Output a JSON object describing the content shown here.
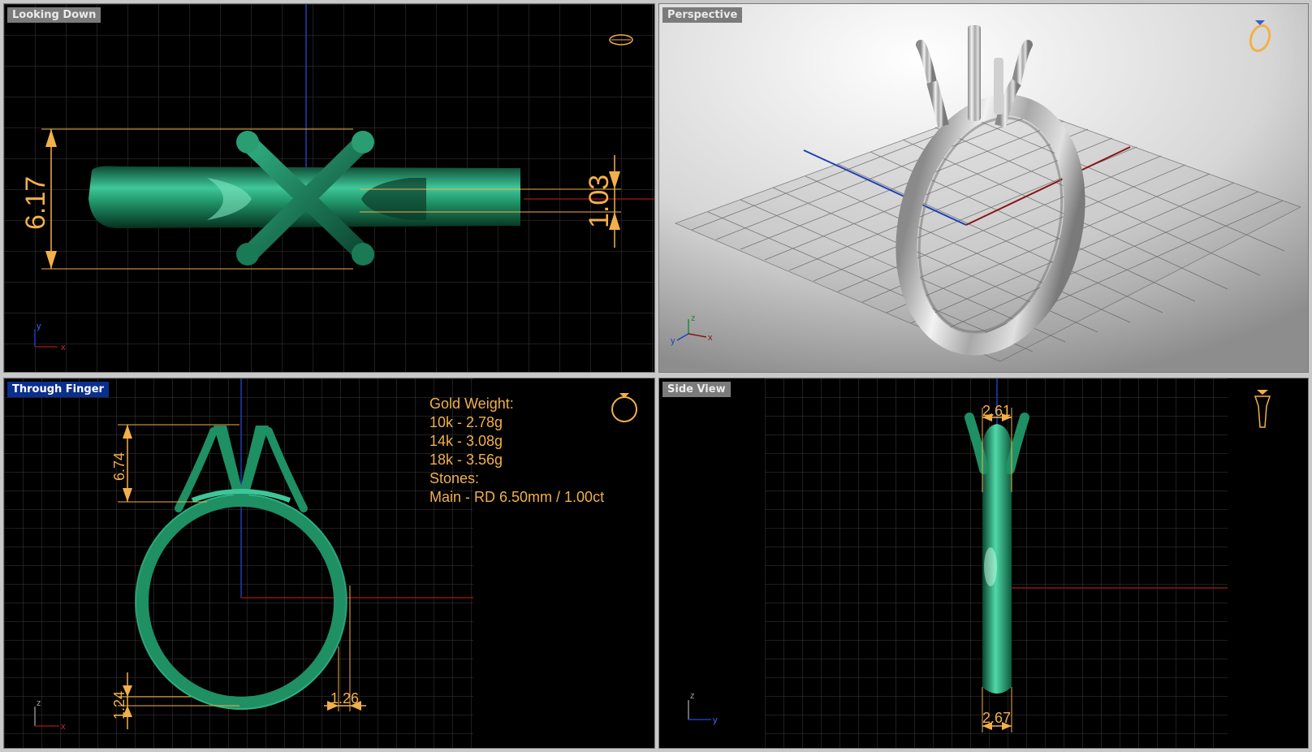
{
  "viewports": {
    "top": {
      "label": "Looking Down",
      "dim_width": "6.17",
      "dim_band": "1.03",
      "axis_y": "y",
      "axis_x": "x"
    },
    "perspective": {
      "label": "Perspective",
      "axis_z": "z",
      "axis_y": "y",
      "axis_x": "x"
    },
    "front": {
      "label": "Through Finger",
      "dim_prong": "6.74",
      "dim_bottom_thickness": "1.24",
      "dim_band_thickness": "1.26",
      "axis_z": "z",
      "axis_x": "x",
      "info": {
        "heading": "Gold Weight:",
        "lines": [
          "10k - 2.78g",
          "14k - 3.08g",
          "18k - 3.56g"
        ],
        "stones_heading": "Stones:",
        "main_stone": "Main - RD 6.50mm / 1.00ct"
      }
    },
    "side": {
      "label": "Side View",
      "dim_top": "2.61",
      "dim_bottom": "2.67",
      "axis_z": "z",
      "axis_y": "y"
    }
  },
  "colors": {
    "grid_bg": "#000000",
    "grid_line": "#3a3a3a",
    "ring_green": "#1f8f64",
    "dimension": "#f2b04a",
    "active_label_bg": "#0b2f8f",
    "inactive_label_bg": "#7b7b7b",
    "metal_silver": "#c8c8c8"
  }
}
